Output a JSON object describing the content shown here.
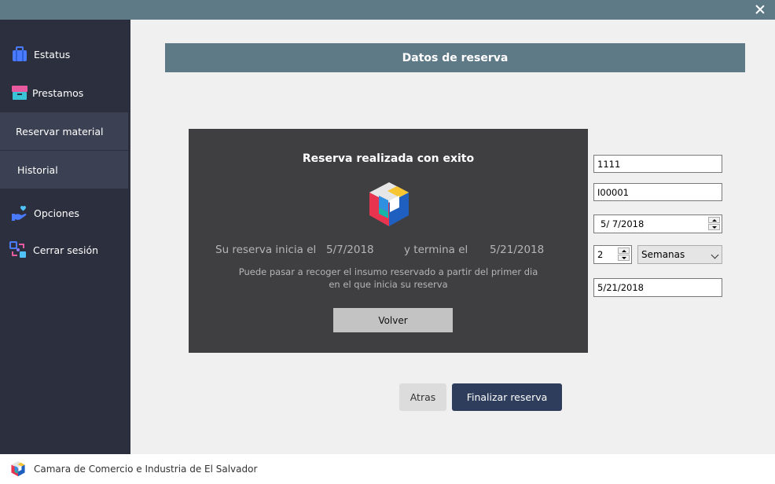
{
  "sidebar": {
    "items": [
      {
        "label": "Estatus",
        "icon": "briefcase-icon"
      },
      {
        "label": "Prestamos",
        "icon": "archive-box-icon"
      },
      {
        "label": "Reservar material"
      },
      {
        "label": "Historial"
      },
      {
        "label": "Opciones",
        "icon": "hand-heart-icon"
      },
      {
        "label": "Cerrar sesión",
        "icon": "logout-swap-icon"
      }
    ]
  },
  "header": {
    "title": "Datos de reserva"
  },
  "form": {
    "field1": "1111",
    "field2": "I00001",
    "start_date": "5/  7/2018",
    "duration_value": "2",
    "duration_unit": "Semanas",
    "end_date": "5/21/2018"
  },
  "buttons": {
    "back": "Atras",
    "finish": "Finalizar reserva"
  },
  "modal": {
    "title": "Reserva realizada con exito",
    "starts_label": "Su reserva inicia el",
    "start_date": "5/7/2018",
    "ends_label": "y  termina el",
    "end_date": "5/21/2018",
    "note_line1": "Puede pasar a recoger el insumo reservado a partir del primer dia",
    "note_line2": "en el que inicia su reserva",
    "back_button": "Volver"
  },
  "footer": {
    "org_name": "Camara de Comercio e Industria de El Salvador"
  },
  "colors": {
    "titlebar": "#5f7a87",
    "sidebar": "#2c2f3d",
    "modal": "#3f3f42",
    "primary_button": "#2e3d5c"
  }
}
